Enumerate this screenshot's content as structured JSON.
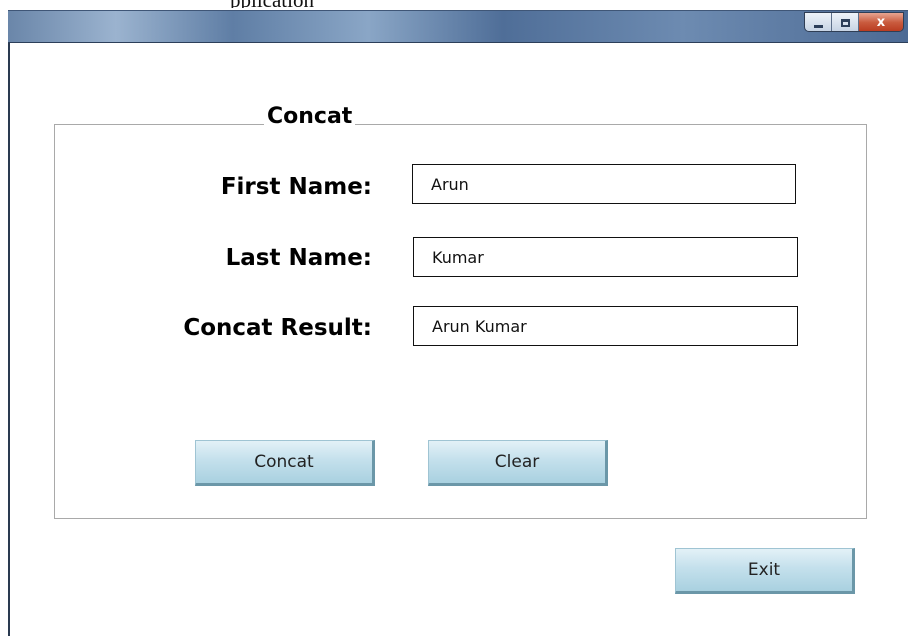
{
  "app": {
    "cropped_title": "pplication",
    "caption_buttons": {
      "minimize_icon": "minimize-icon",
      "maximize_icon": "maximize-icon",
      "close_glyph": "x"
    }
  },
  "form": {
    "group_title": "Concat",
    "first_name": {
      "label": "First Name:",
      "value": "Arun"
    },
    "last_name": {
      "label": "Last Name:",
      "value": "Kumar"
    },
    "concat_result": {
      "label": "Concat Result:",
      "value": "Arun Kumar"
    },
    "concat_button": "Concat",
    "clear_button": "Clear"
  },
  "footer": {
    "exit_button": "Exit"
  },
  "colors": {
    "titlebar": "#5f7ea5",
    "button_face": "#c4e0ec",
    "close_button": "#c95b3e",
    "groupbox_border": "#a9a9a9"
  }
}
